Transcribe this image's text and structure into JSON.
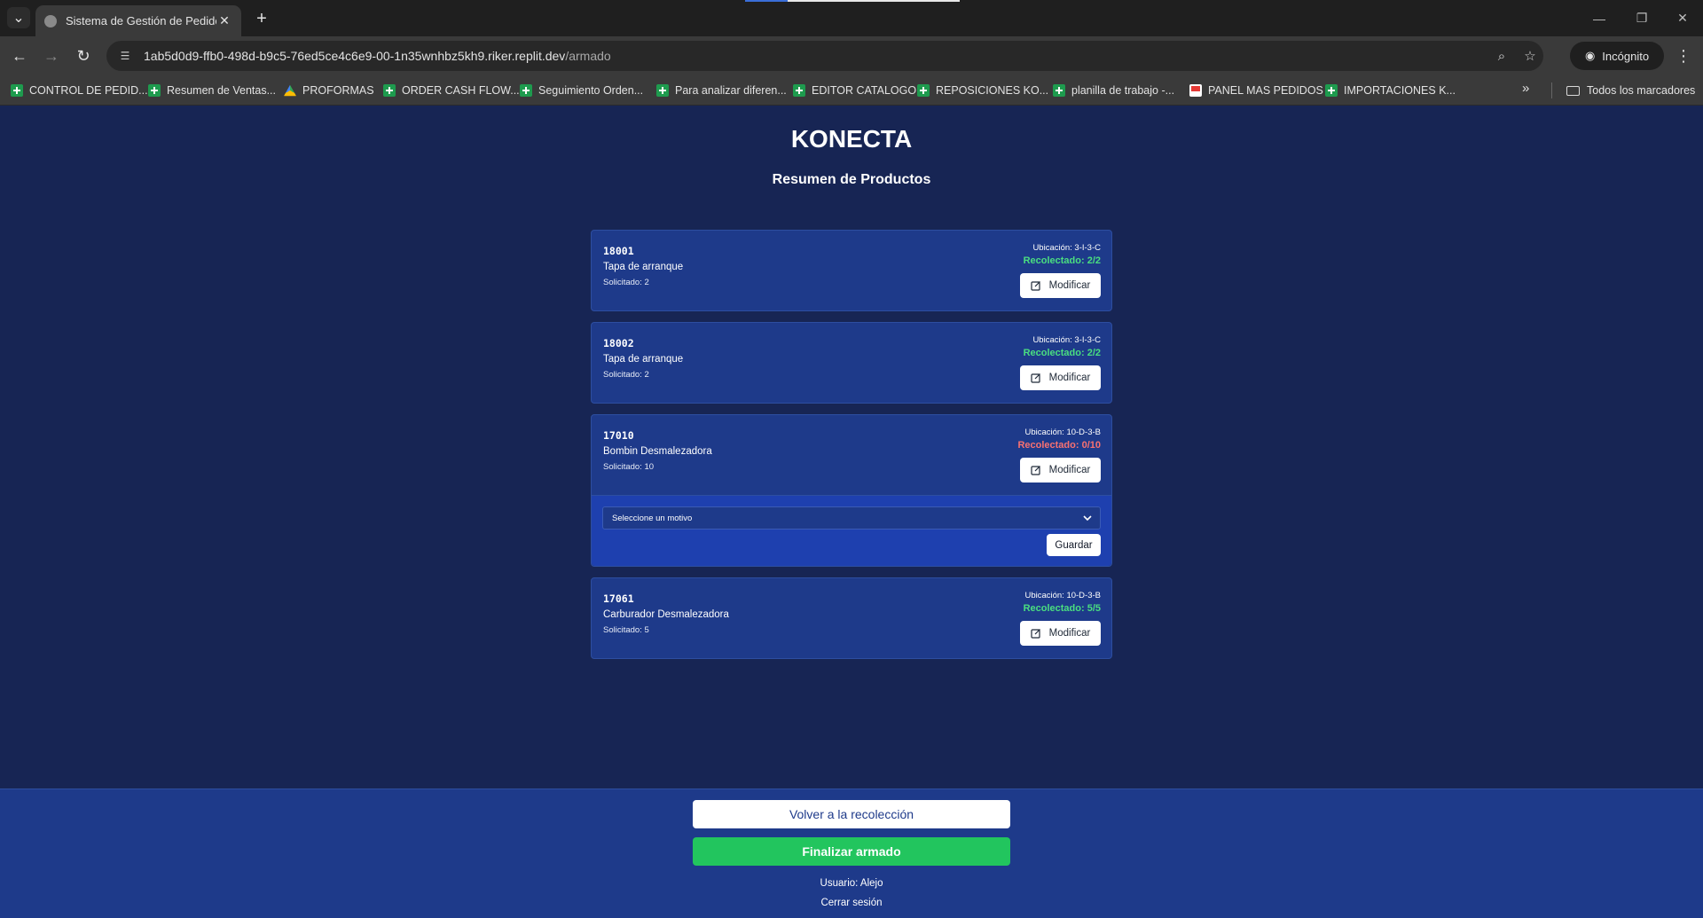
{
  "browser": {
    "tab_title": "Sistema de Gestión de Pedidos",
    "url_host": "1ab5d0d9-ffb0-498d-b9c5-76ed5ce4c6e9-00-1n35wnhbz5kh9.riker.replit.dev",
    "url_path": "/armado",
    "incognito_label": "Incógnito",
    "bookmarks": [
      {
        "label": "CONTROL DE PEDID...",
        "icon": "sheets-icon"
      },
      {
        "label": "Resumen de Ventas...",
        "icon": "sheets-icon"
      },
      {
        "label": "PROFORMAS",
        "icon": "drive-icon"
      },
      {
        "label": "ORDER CASH FLOW...",
        "icon": "sheets-icon"
      },
      {
        "label": "Seguimiento Orden...",
        "icon": "sheets-icon"
      },
      {
        "label": "Para analizar diferen...",
        "icon": "sheets-icon"
      },
      {
        "label": "EDITOR CATALOGO",
        "icon": "sheets-icon"
      },
      {
        "label": "REPOSICIONES KO...",
        "icon": "sheets-icon"
      },
      {
        "label": "planilla de trabajo -...",
        "icon": "sheets-icon"
      },
      {
        "label": "PANEL MAS PEDIDOS",
        "icon": "doc-icon"
      },
      {
        "label": "IMPORTACIONES K...",
        "icon": "sheets-icon"
      }
    ],
    "all_bookmarks_label": "Todos los marcadores"
  },
  "header": {
    "brand": "KONECTA",
    "subtitle": "Resumen de Productos"
  },
  "products": [
    {
      "code": "18001",
      "name": "Tapa de arranque",
      "requested": "Solicitado: 2",
      "location": "Ubicación: 3-I-3-C",
      "collected": "Recolectado: 2/2",
      "status": "complete",
      "modify_label": "Modificar"
    },
    {
      "code": "18002",
      "name": "Tapa de arranque",
      "requested": "Solicitado: 2",
      "location": "Ubicación: 3-I-3-C",
      "collected": "Recolectado: 2/2",
      "status": "complete",
      "modify_label": "Modificar"
    },
    {
      "code": "17010",
      "name": "Bombin Desmalezadora",
      "requested": "Solicitado: 10",
      "location": "Ubicación: 10-D-3-B",
      "collected": "Recolectado: 0/10",
      "status": "incomplete",
      "modify_label": "Modificar",
      "reason_placeholder": "Seleccione un motivo",
      "save_label": "Guardar"
    },
    {
      "code": "17061",
      "name": "Carburador Desmalezadora",
      "requested": "Solicitado: 5",
      "location": "Ubicación: 10-D-3-B",
      "collected": "Recolectado: 5/5",
      "status": "complete",
      "modify_label": "Modificar"
    }
  ],
  "footer": {
    "back_label": "Volver a la recolección",
    "finish_label": "Finalizar armado",
    "user": "Usuario: Alejo",
    "logout_label": "Cerrar sesión"
  },
  "colors": {
    "background": "#172554",
    "card": "#1e3a8a",
    "ok": "#4ade80",
    "bad": "#f87171",
    "finish": "#22c55e"
  }
}
